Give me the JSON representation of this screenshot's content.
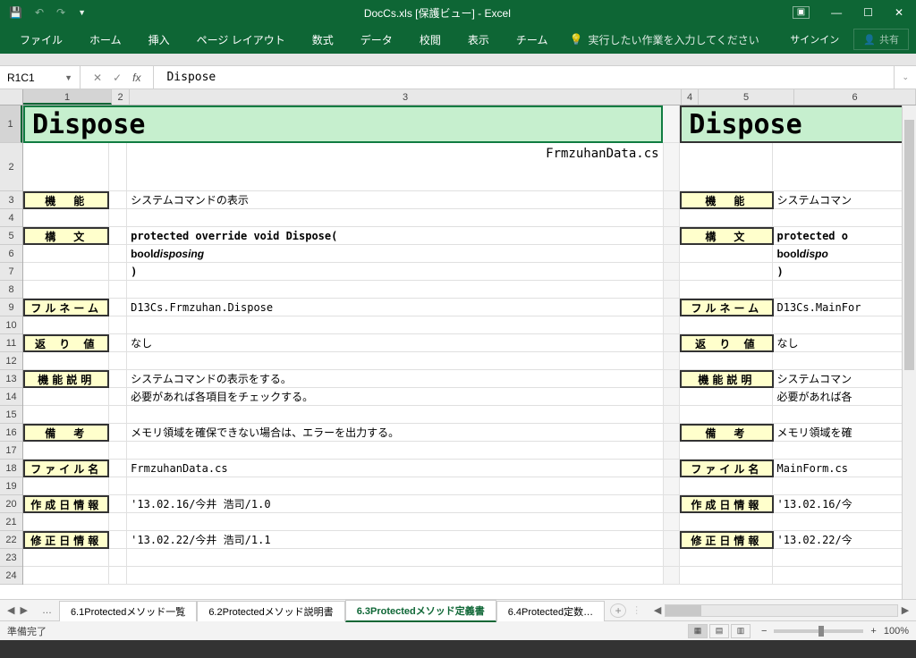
{
  "title": "DocCs.xls  [保護ビュー] - Excel",
  "ribbon": {
    "tabs": [
      "ファイル",
      "ホーム",
      "挿入",
      "ページ レイアウト",
      "数式",
      "データ",
      "校閲",
      "表示",
      "チーム"
    ],
    "tell": "実行したい作業を入力してください",
    "signin": "サインイン",
    "share": "共有"
  },
  "formula": {
    "name": "R1C1",
    "value": "Dispose"
  },
  "cols": {
    "n": [
      "1",
      "2",
      "3",
      "4",
      "5",
      "6"
    ],
    "w": [
      99,
      20,
      617,
      19,
      107,
      124
    ]
  },
  "rows": {
    "heights": [
      42,
      54,
      20,
      20,
      20,
      20,
      20,
      20,
      20,
      20,
      20,
      20,
      20,
      20,
      20,
      20,
      20,
      20,
      20,
      20,
      20,
      20,
      20,
      20
    ],
    "nums": [
      "1",
      "2",
      "3",
      "4",
      "5",
      "6",
      "7",
      "8",
      "9",
      "10",
      "11",
      "12",
      "13",
      "14",
      "15",
      "16",
      "17",
      "18",
      "19",
      "20",
      "21",
      "22",
      "23",
      "24"
    ]
  },
  "left": {
    "title": "Dispose",
    "filename_top": "FrmzuhanData.cs",
    "labels": {
      "func": "機　能",
      "syntax": "構　文",
      "fullname": "フルネーム",
      "ret": "返 り 値",
      "desc": "機能説明",
      "notes": "備　考",
      "file": "ファイル名",
      "created": "作成日情報",
      "modified": "修正日情報"
    },
    "vals": {
      "func": "システムコマンドの表示",
      "syntax1": "protected override void Dispose(",
      "syntax2": " bool ",
      "syntax2i": "disposing",
      "syntax3": ")",
      "fullname": "D13Cs.Frmzuhan.Dispose",
      "ret": "なし",
      "desc1": "システムコマンドの表示をする。",
      "desc2": "必要があれば各項目をチェックする。",
      "notes": "メモリ領域を確保できない場合は、エラーを出力する。",
      "file": "FrmzuhanData.cs",
      "created": "'13.02.16/今井 浩司/1.0",
      "modified": "'13.02.22/今井 浩司/1.1"
    }
  },
  "right": {
    "title": "Dispose",
    "vals": {
      "func": "システムコマン",
      "syntax1": "protected o",
      "syntax2": " bool ",
      "syntax2i": "dispo",
      "syntax3": ")",
      "fullname": "D13Cs.MainFor",
      "ret": "なし",
      "desc1": "システムコマン",
      "desc2": "必要があれば各",
      "notes": "メモリ領域を確",
      "file": "MainForm.cs",
      "created": "'13.02.16/今",
      "modified": "'13.02.22/今"
    }
  },
  "sheets": {
    "list": [
      "6.1Protectedメソッド一覧",
      "6.2Protectedメソッド説明書",
      "6.3Protectedメソッド定義書",
      "6.4Protected定数…"
    ],
    "active": 2
  },
  "status": {
    "ready": "準備完了",
    "zoom": "100%"
  }
}
